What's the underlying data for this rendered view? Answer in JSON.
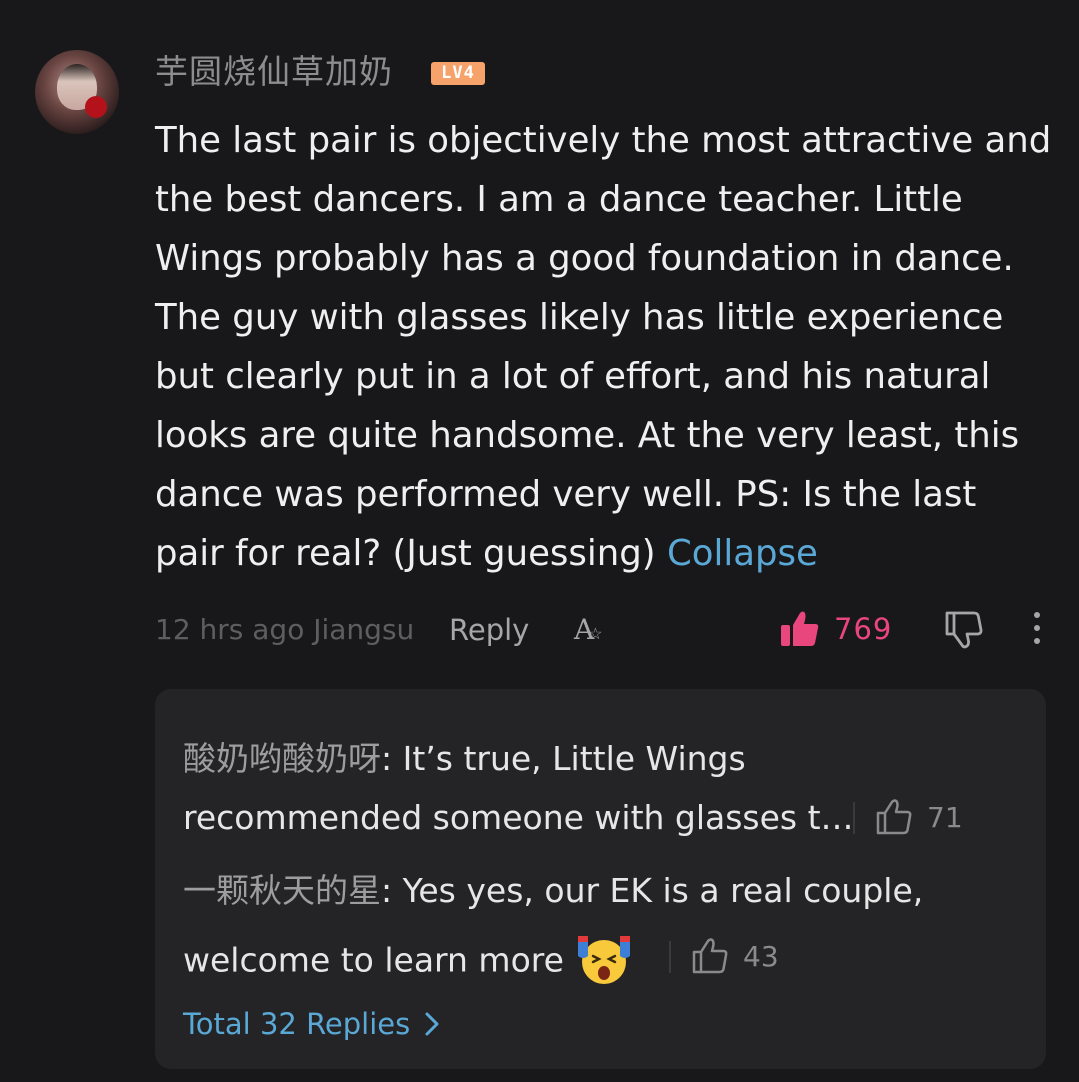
{
  "comment": {
    "username": "芋圆烧仙草加奶",
    "level": "LV4",
    "text": "The last pair is objectively the most attractive and the best dancers. I am a dance teacher. Little Wings probably has a good foundation in dance. The guy with glasses likely has little experience but clearly put in a lot of effort, and his natural looks are quite handsome. At the very least, this dance was performed very well. PS: Is the last pair for real? (Just guessing)",
    "collapse_label": "Collapse",
    "meta": "12 hrs ago Jiangsu",
    "reply_label": "Reply",
    "translate_label": "A",
    "like_count": "769",
    "colors": {
      "accent": "#e8467c",
      "link": "#5aa8d6",
      "badge": "#f6a36b"
    },
    "icons": [
      "avatar",
      "thumbs-up-icon",
      "thumbs-down-icon",
      "more-vertical-icon",
      "translate-icon"
    ]
  },
  "replies": {
    "items": [
      {
        "author": "酸奶哟酸奶呀",
        "line1": ": It’s true, Little Wings",
        "line2": "recommended someone with glasses t…",
        "likes": "71"
      },
      {
        "author": "一颗秋天的星",
        "line1": ": Yes yes, our EK is a real couple,",
        "line2": "welcome to learn more",
        "emoji": "shocked-face-emoji",
        "likes": "43"
      }
    ],
    "total_label": "Total 32 Replies"
  }
}
